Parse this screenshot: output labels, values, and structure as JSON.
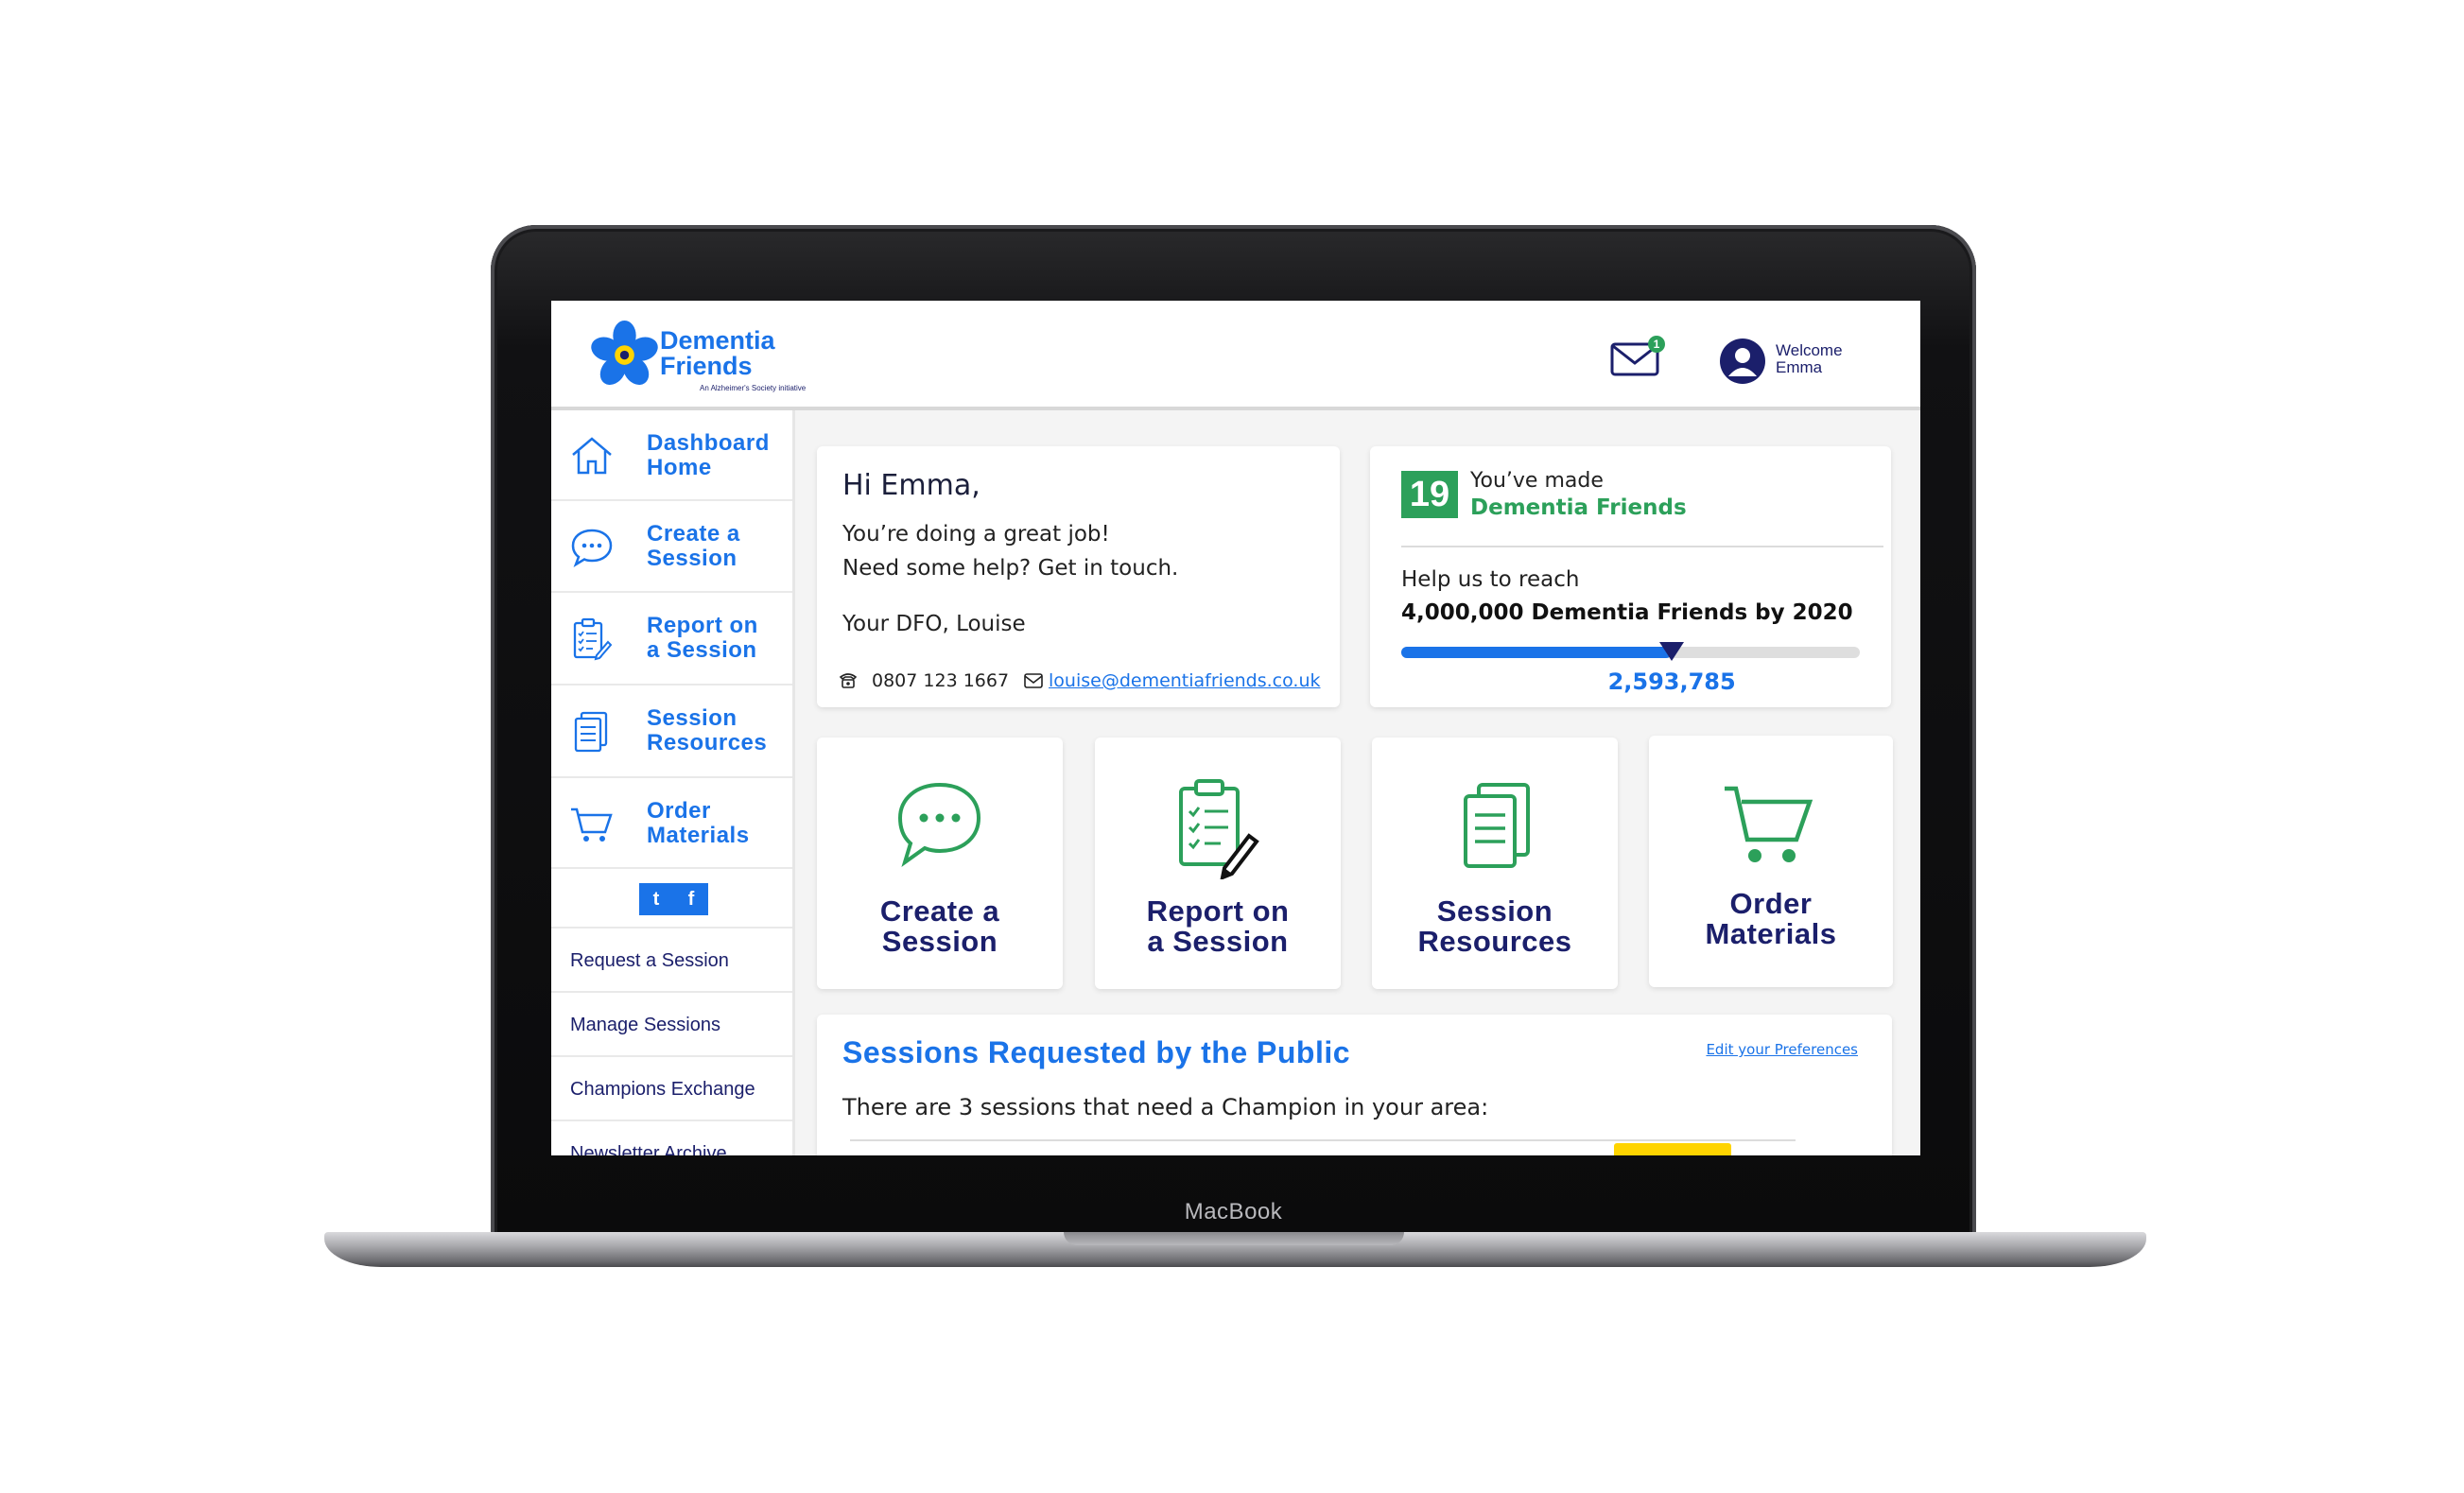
{
  "device": {
    "label": "MacBook"
  },
  "header": {
    "logo_line1": "Dementia",
    "logo_line2": "Friends",
    "logo_sub": "An Alzheimer's Society initiative",
    "mail_badge": "1",
    "welcome_line1": "Welcome",
    "welcome_line2": "Emma",
    "icons": {
      "mail": "envelope-icon",
      "user": "user-avatar-icon",
      "logo": "forget-me-not-flower-icon"
    }
  },
  "sidebar": {
    "items": [
      {
        "line1": "Dashboard",
        "line2": "Home",
        "icon": "house-icon"
      },
      {
        "line1": "Create a",
        "line2": "Session",
        "icon": "speech-bubble-icon"
      },
      {
        "line1": "Report on",
        "line2": "a Session",
        "icon": "clipboard-pencil-icon"
      },
      {
        "line1": "Session",
        "line2": "Resources",
        "icon": "documents-icon"
      },
      {
        "line1": "Order",
        "line2": "Materials",
        "icon": "shopping-cart-icon"
      }
    ],
    "social": {
      "twitter": "t",
      "facebook": "f"
    },
    "links": [
      "Request a Session",
      "Manage Sessions",
      "Champions Exchange",
      "Newsletter Archive"
    ]
  },
  "greeting": {
    "title": "Hi Emma,",
    "line1": "You’re doing a great job!",
    "line2": "Need some help? Get in touch.",
    "line3": "Your DFO, Louise",
    "phone": "0807 123 1667",
    "email": "louise@dementiafriends.co.uk"
  },
  "progress": {
    "count": "19",
    "made_line1": "You’ve made",
    "made_line2": "Dementia Friends",
    "reach_line1": "Help us to reach",
    "reach_line2": "4,000,000 Dementia Friends by 2020",
    "value_label": "2,593,785",
    "fraction": 0.59,
    "colors": {
      "fill": "#1a73e8",
      "marker": "#1b1f6b"
    }
  },
  "tiles": [
    {
      "line1": "Create a",
      "line2": "Session",
      "icon": "speech-bubble-icon"
    },
    {
      "line1": "Report on",
      "line2": "a Session",
      "icon": "clipboard-pencil-icon"
    },
    {
      "line1": "Session",
      "line2": "Resources",
      "icon": "documents-icon"
    },
    {
      "line1": "Order",
      "line2": "Materials",
      "icon": "shopping-cart-icon"
    }
  ],
  "requests": {
    "title": "Sessions Requested by the Public",
    "preferences_link": "Edit your Preferences",
    "text": "There are 3 sessions that need a Champion in your area:"
  },
  "colors": {
    "brand_blue": "#1a73e8",
    "navy": "#1b1f6b",
    "green": "#2ca05a",
    "accent_yellow": "#ffd400"
  }
}
